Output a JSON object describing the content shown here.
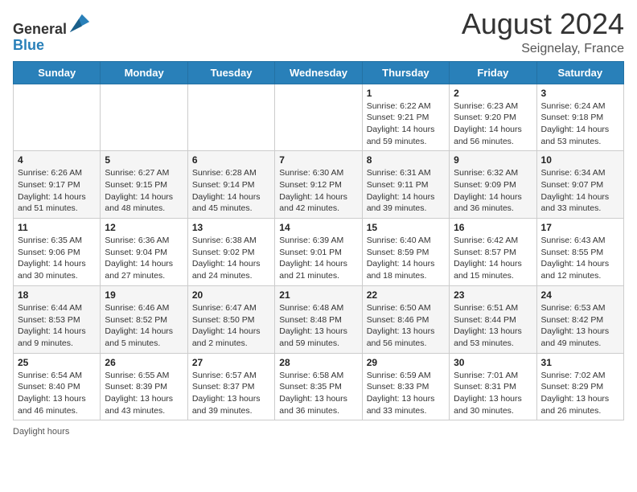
{
  "header": {
    "logo_general": "General",
    "logo_blue": "Blue",
    "month_year": "August 2024",
    "location": "Seignelay, France"
  },
  "footer": {
    "daylight_label": "Daylight hours"
  },
  "days_of_week": [
    "Sunday",
    "Monday",
    "Tuesday",
    "Wednesday",
    "Thursday",
    "Friday",
    "Saturday"
  ],
  "weeks": [
    [
      {
        "day": "",
        "info": ""
      },
      {
        "day": "",
        "info": ""
      },
      {
        "day": "",
        "info": ""
      },
      {
        "day": "",
        "info": ""
      },
      {
        "day": "1",
        "info": "Sunrise: 6:22 AM\nSunset: 9:21 PM\nDaylight: 14 hours and 59 minutes."
      },
      {
        "day": "2",
        "info": "Sunrise: 6:23 AM\nSunset: 9:20 PM\nDaylight: 14 hours and 56 minutes."
      },
      {
        "day": "3",
        "info": "Sunrise: 6:24 AM\nSunset: 9:18 PM\nDaylight: 14 hours and 53 minutes."
      }
    ],
    [
      {
        "day": "4",
        "info": "Sunrise: 6:26 AM\nSunset: 9:17 PM\nDaylight: 14 hours and 51 minutes."
      },
      {
        "day": "5",
        "info": "Sunrise: 6:27 AM\nSunset: 9:15 PM\nDaylight: 14 hours and 48 minutes."
      },
      {
        "day": "6",
        "info": "Sunrise: 6:28 AM\nSunset: 9:14 PM\nDaylight: 14 hours and 45 minutes."
      },
      {
        "day": "7",
        "info": "Sunrise: 6:30 AM\nSunset: 9:12 PM\nDaylight: 14 hours and 42 minutes."
      },
      {
        "day": "8",
        "info": "Sunrise: 6:31 AM\nSunset: 9:11 PM\nDaylight: 14 hours and 39 minutes."
      },
      {
        "day": "9",
        "info": "Sunrise: 6:32 AM\nSunset: 9:09 PM\nDaylight: 14 hours and 36 minutes."
      },
      {
        "day": "10",
        "info": "Sunrise: 6:34 AM\nSunset: 9:07 PM\nDaylight: 14 hours and 33 minutes."
      }
    ],
    [
      {
        "day": "11",
        "info": "Sunrise: 6:35 AM\nSunset: 9:06 PM\nDaylight: 14 hours and 30 minutes."
      },
      {
        "day": "12",
        "info": "Sunrise: 6:36 AM\nSunset: 9:04 PM\nDaylight: 14 hours and 27 minutes."
      },
      {
        "day": "13",
        "info": "Sunrise: 6:38 AM\nSunset: 9:02 PM\nDaylight: 14 hours and 24 minutes."
      },
      {
        "day": "14",
        "info": "Sunrise: 6:39 AM\nSunset: 9:01 PM\nDaylight: 14 hours and 21 minutes."
      },
      {
        "day": "15",
        "info": "Sunrise: 6:40 AM\nSunset: 8:59 PM\nDaylight: 14 hours and 18 minutes."
      },
      {
        "day": "16",
        "info": "Sunrise: 6:42 AM\nSunset: 8:57 PM\nDaylight: 14 hours and 15 minutes."
      },
      {
        "day": "17",
        "info": "Sunrise: 6:43 AM\nSunset: 8:55 PM\nDaylight: 14 hours and 12 minutes."
      }
    ],
    [
      {
        "day": "18",
        "info": "Sunrise: 6:44 AM\nSunset: 8:53 PM\nDaylight: 14 hours and 9 minutes."
      },
      {
        "day": "19",
        "info": "Sunrise: 6:46 AM\nSunset: 8:52 PM\nDaylight: 14 hours and 5 minutes."
      },
      {
        "day": "20",
        "info": "Sunrise: 6:47 AM\nSunset: 8:50 PM\nDaylight: 14 hours and 2 minutes."
      },
      {
        "day": "21",
        "info": "Sunrise: 6:48 AM\nSunset: 8:48 PM\nDaylight: 13 hours and 59 minutes."
      },
      {
        "day": "22",
        "info": "Sunrise: 6:50 AM\nSunset: 8:46 PM\nDaylight: 13 hours and 56 minutes."
      },
      {
        "day": "23",
        "info": "Sunrise: 6:51 AM\nSunset: 8:44 PM\nDaylight: 13 hours and 53 minutes."
      },
      {
        "day": "24",
        "info": "Sunrise: 6:53 AM\nSunset: 8:42 PM\nDaylight: 13 hours and 49 minutes."
      }
    ],
    [
      {
        "day": "25",
        "info": "Sunrise: 6:54 AM\nSunset: 8:40 PM\nDaylight: 13 hours and 46 minutes."
      },
      {
        "day": "26",
        "info": "Sunrise: 6:55 AM\nSunset: 8:39 PM\nDaylight: 13 hours and 43 minutes."
      },
      {
        "day": "27",
        "info": "Sunrise: 6:57 AM\nSunset: 8:37 PM\nDaylight: 13 hours and 39 minutes."
      },
      {
        "day": "28",
        "info": "Sunrise: 6:58 AM\nSunset: 8:35 PM\nDaylight: 13 hours and 36 minutes."
      },
      {
        "day": "29",
        "info": "Sunrise: 6:59 AM\nSunset: 8:33 PM\nDaylight: 13 hours and 33 minutes."
      },
      {
        "day": "30",
        "info": "Sunrise: 7:01 AM\nSunset: 8:31 PM\nDaylight: 13 hours and 30 minutes."
      },
      {
        "day": "31",
        "info": "Sunrise: 7:02 AM\nSunset: 8:29 PM\nDaylight: 13 hours and 26 minutes."
      }
    ]
  ]
}
